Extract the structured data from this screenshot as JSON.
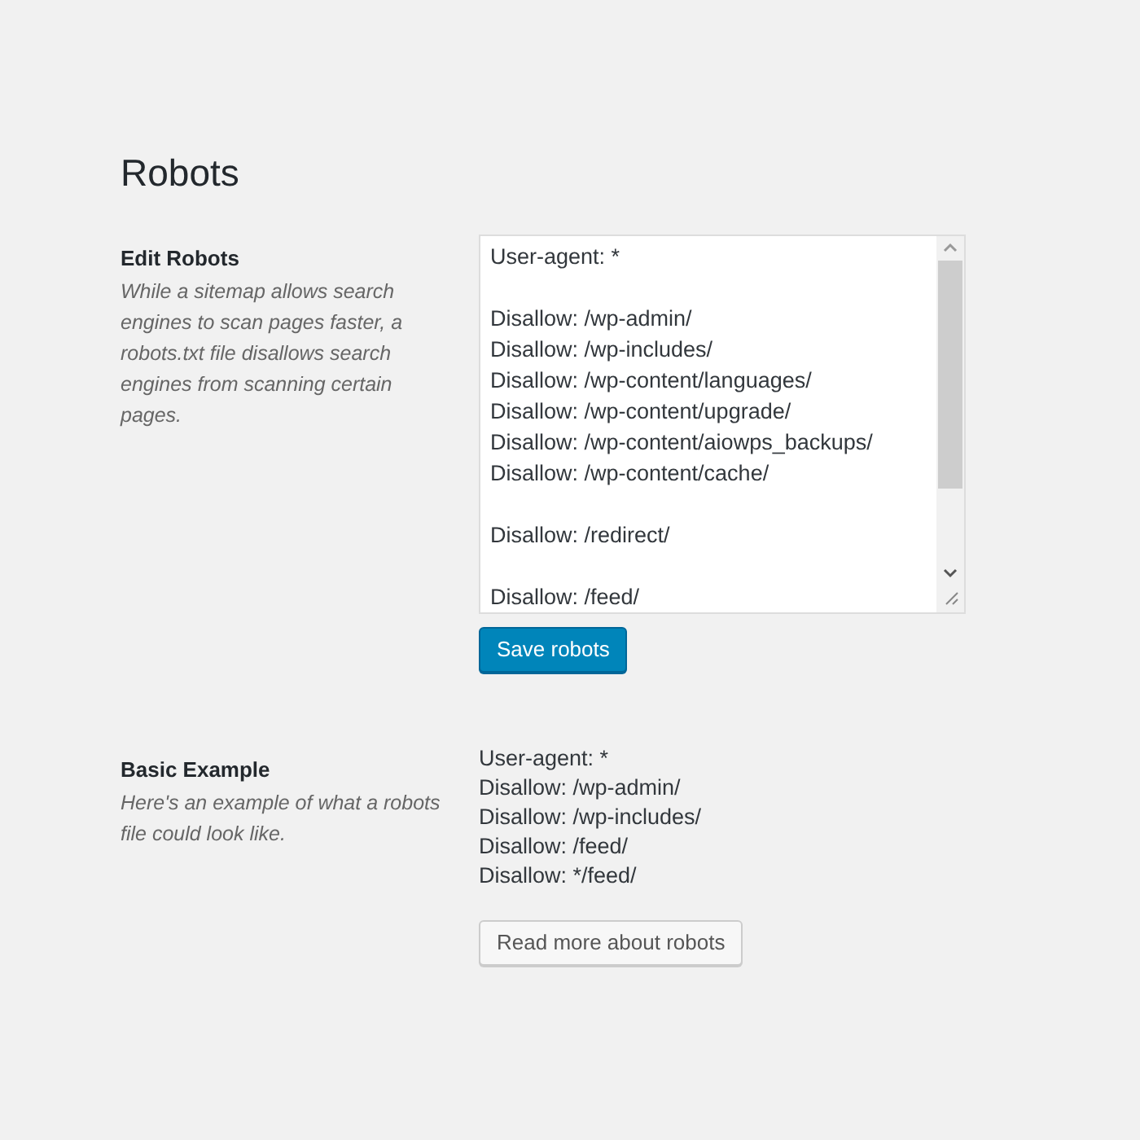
{
  "heading": "Robots",
  "edit_section": {
    "title": "Edit Robots",
    "description": "While a sitemap allows search engines to scan pages faster, a robots.txt file disallows search engines from scanning certain pages.",
    "editor_blocks": [
      [
        "User-agent: *"
      ],
      [
        "Disallow: /wp-admin/",
        "Disallow: /wp-includes/",
        "Disallow: /wp-content/languages/",
        "Disallow: /wp-content/upgrade/",
        "Disallow: /wp-content/aiowps_backups/",
        "Disallow: /wp-content/cache/"
      ],
      [
        "Disallow: /redirect/"
      ],
      [
        "Disallow: /feed/"
      ]
    ],
    "button": "Save robots"
  },
  "example_section": {
    "title": "Basic Example",
    "description": "Here's an example of what a robots file could look like.",
    "lines": [
      "User-agent: *",
      "Disallow: /wp-admin/",
      "Disallow: /wp-includes/",
      "Disallow: /feed/",
      "Disallow: */feed/"
    ],
    "button": "Read more about robots"
  }
}
